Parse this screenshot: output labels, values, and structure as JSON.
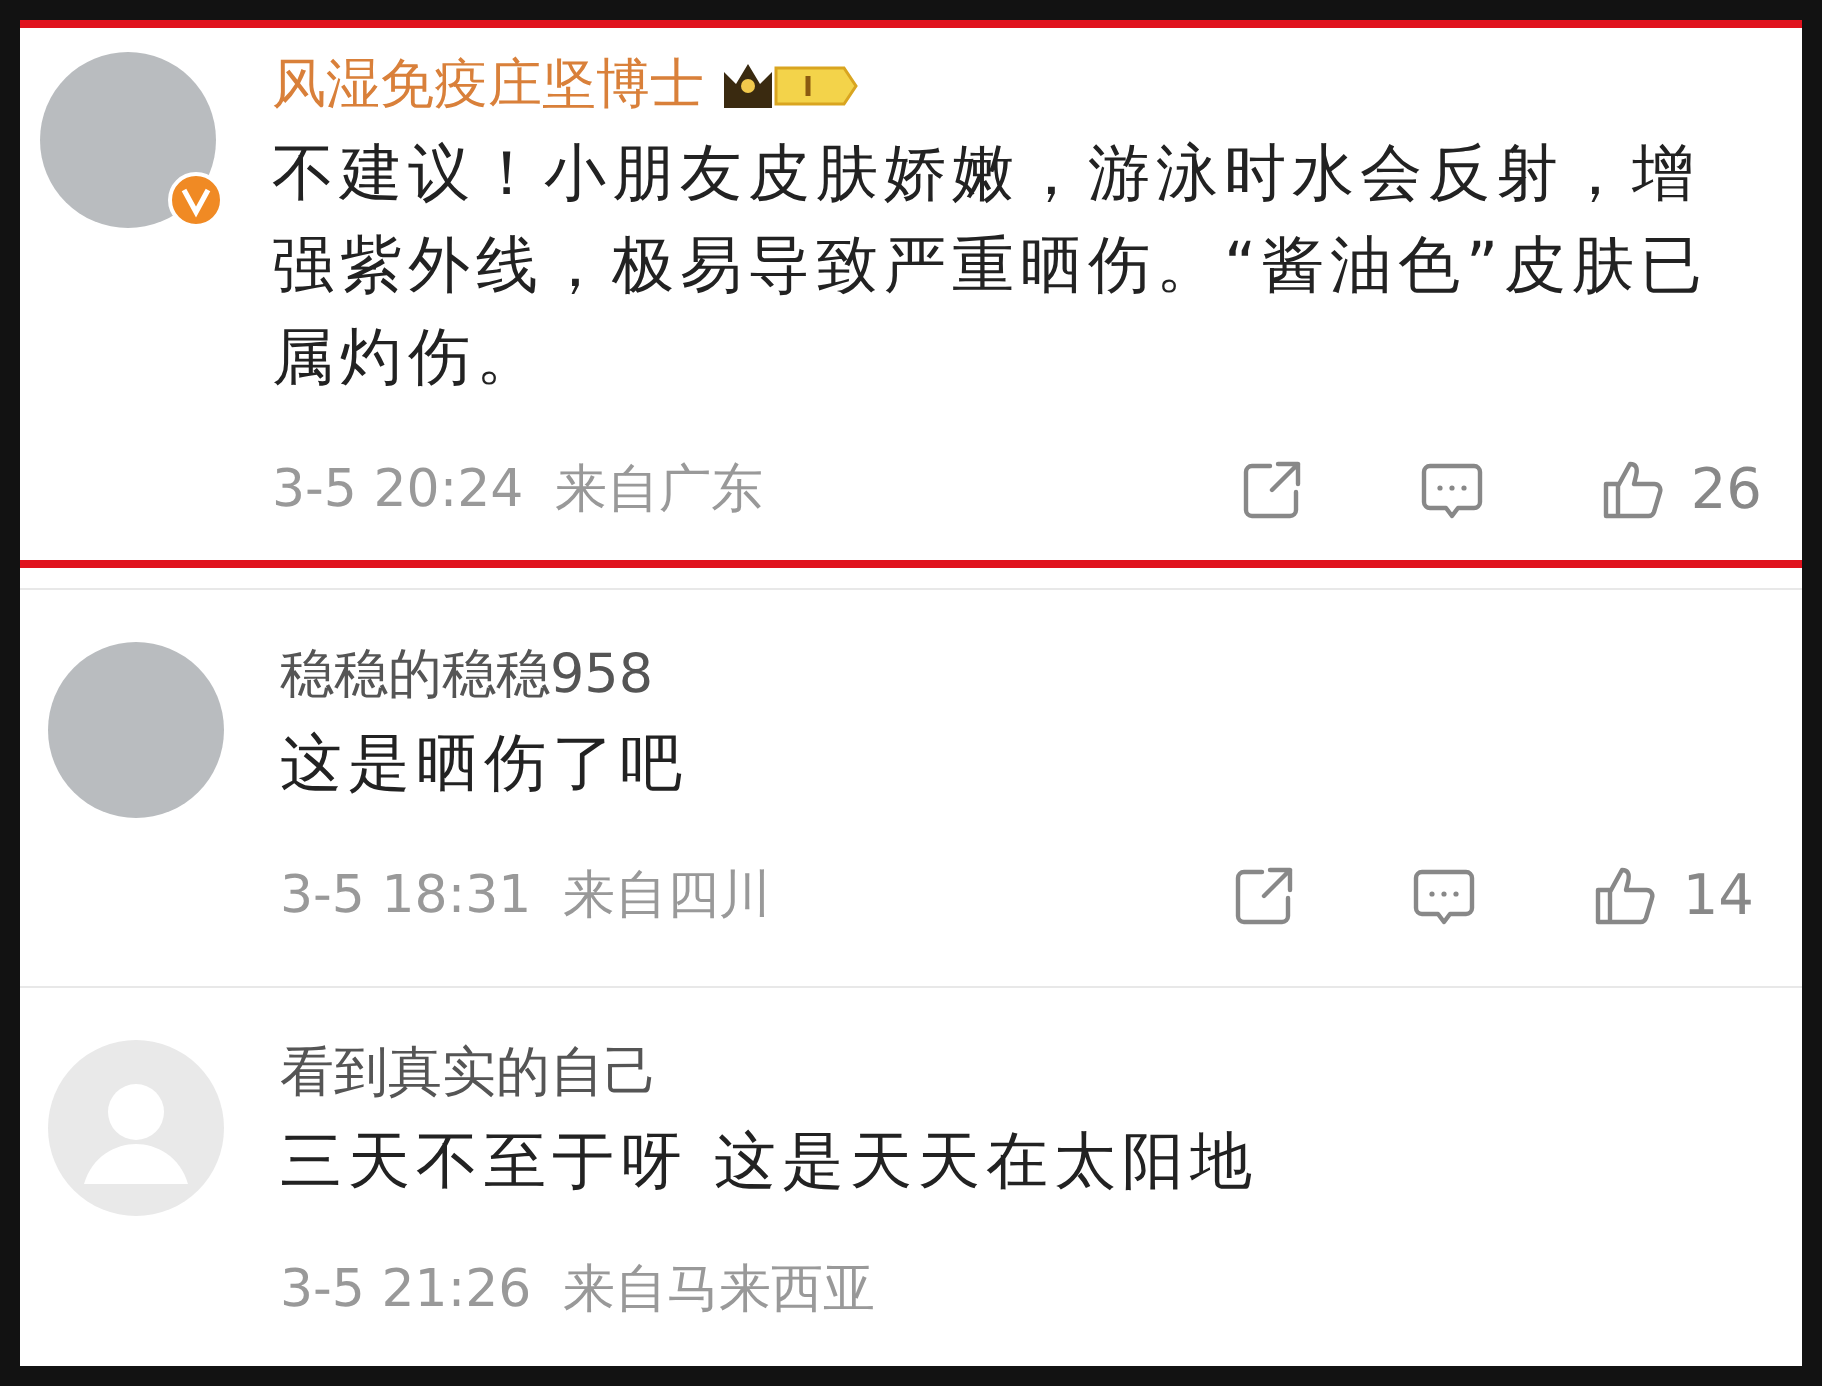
{
  "comments": [
    {
      "name": "风湿免疫庄坚博士",
      "vip": true,
      "verified": true,
      "highlighted": true,
      "avatar": {
        "kind": "photo"
      },
      "text": "不建议！小朋友皮肤娇嫩，游泳时水会反射，增强紫外线，极易导致严重晒伤。“酱油色”皮肤已属灼伤。",
      "time": "3-5 20:24",
      "location": "来自广东",
      "likes": "26"
    },
    {
      "name": "稳稳的稳稳958",
      "vip": false,
      "verified": false,
      "highlighted": false,
      "avatar": {
        "kind": "photo"
      },
      "text": "这是晒伤了吧",
      "time": "3-5 18:31",
      "location": "来自四川",
      "likes": "14"
    },
    {
      "name": "看到真实的自己",
      "vip": false,
      "verified": false,
      "highlighted": false,
      "avatar": {
        "kind": "default"
      },
      "text": "三天不至于呀 这是天天在太阳地",
      "time": "3-5 21:26",
      "location": "来自马来西亚"
    }
  ]
}
